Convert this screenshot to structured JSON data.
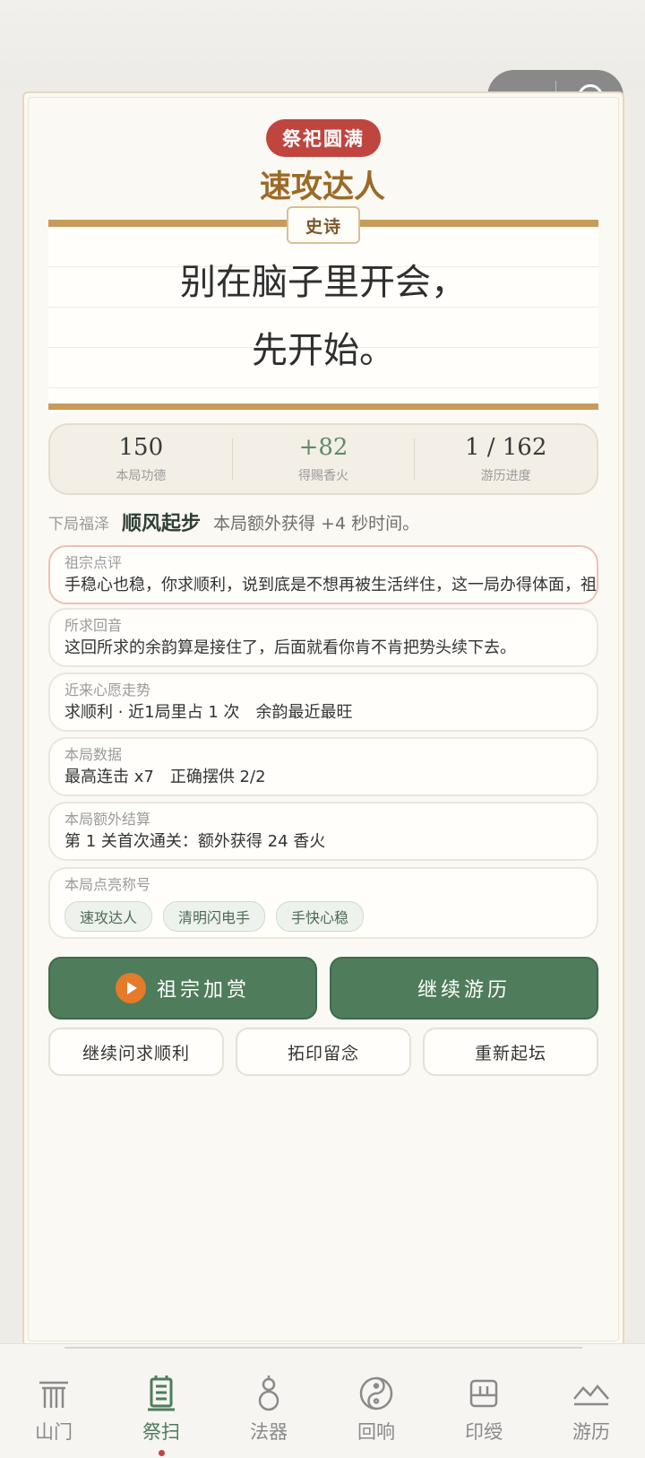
{
  "badge": "祭祀圆满",
  "title": "速攻达人",
  "rarity": "史诗",
  "quote": {
    "line1": "别在脑子里开会，",
    "line2": "先开始。"
  },
  "stats": [
    {
      "value": "150",
      "label": "本局功德"
    },
    {
      "value": "+82",
      "label": "得赐香火"
    },
    {
      "value": "1 / 162",
      "label": "游历进度"
    }
  ],
  "blessing": {
    "key": "下局福泽",
    "name": "顺风起步",
    "desc": "本局额外获得 +4 秒时间。"
  },
  "review": {
    "label": "祖宗点评",
    "text": "手稳心也稳，你求顺利，说到底是不想再被生活绊住，这一局办得体面，祖宗也替你高兴。"
  },
  "echo": {
    "label": "所求回音",
    "text": "这回所求的余韵算是接住了，后面就看你肯不肯把势头续下去。"
  },
  "trend": {
    "label": "近来心愿走势",
    "text": "求顺利 · 近1局里占 1 次　余韵最近最旺"
  },
  "round_data": {
    "label": "本局数据",
    "text": "最高连击 x7　正确摆供 2/2"
  },
  "extra": {
    "label": "本局额外结算",
    "text": "第 1 关首次通关：额外获得 24 香火"
  },
  "titles": {
    "label": "本局点亮称号",
    "chips": [
      "速攻达人",
      "清明闪电手",
      "手快心稳"
    ]
  },
  "buttons": {
    "reward": "祖宗加赏",
    "continue_travel": "继续游历",
    "continue_ask": "继续问求顺利",
    "rubbing": "拓印留念",
    "restart": "重新起坛"
  },
  "tabs": [
    {
      "label": "山门",
      "icon": "gate-icon"
    },
    {
      "label": "祭扫",
      "icon": "tablet-icon"
    },
    {
      "label": "法器",
      "icon": "gourd-icon"
    },
    {
      "label": "回响",
      "icon": "yinyang-icon"
    },
    {
      "label": "印绶",
      "icon": "seal-icon"
    },
    {
      "label": "游历",
      "icon": "mountain-icon"
    }
  ],
  "active_tab": "祭扫",
  "colors": {
    "primary_green": "#4f7c5b",
    "badge_red": "#c0453f",
    "title_gold": "#9c6a28",
    "play_orange": "#e47a2a"
  }
}
